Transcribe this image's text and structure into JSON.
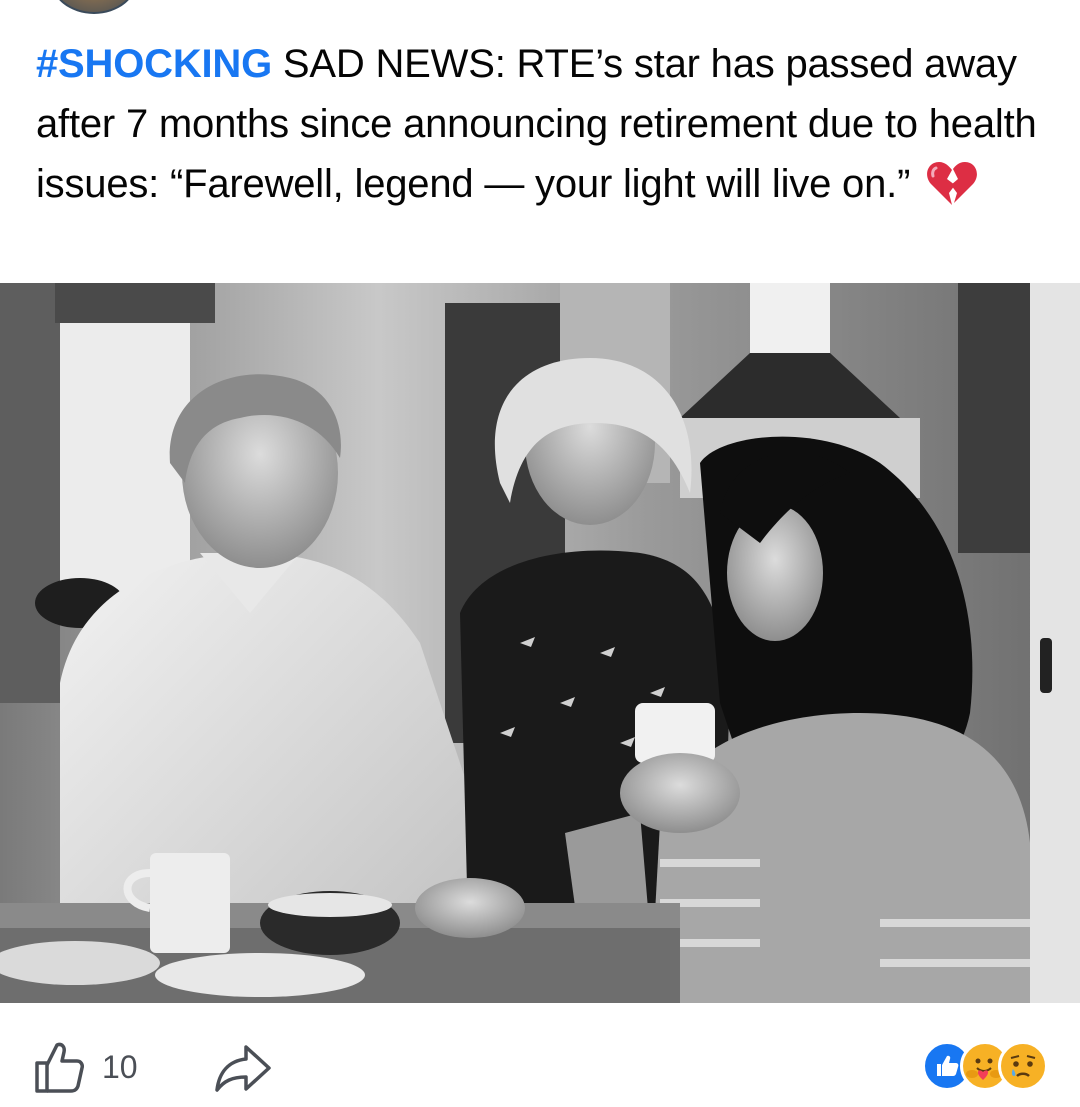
{
  "post": {
    "caption": {
      "hashtag": "#SHOCKING",
      "text": " SAD NEWS: RTE’s star has passed away after 7 months since announcing retirement due to health issues: “Farewell, legend — your light will live on.”",
      "emoji_icon": "broken-heart-icon"
    },
    "image": {
      "style": "black-and-white photo",
      "icon": "photo"
    },
    "actions": {
      "like_icon": "thumbs-up-icon",
      "like_count": "10",
      "share_icon": "share-arrow-icon"
    },
    "reactions": [
      {
        "icon": "like-reaction-icon",
        "color": "#1877f2"
      },
      {
        "icon": "care-reaction-icon",
        "color": "#f7b125"
      },
      {
        "icon": "sad-reaction-icon",
        "color": "#f7b125"
      }
    ]
  }
}
